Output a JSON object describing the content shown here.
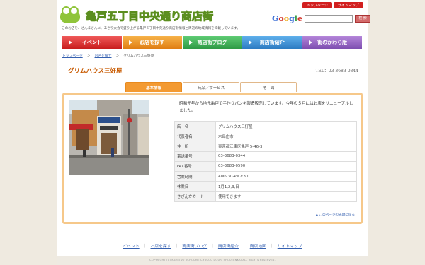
{
  "header": {
    "title": "亀戸五丁目中央通り商店街",
    "tagline": "このお店を、さんまさんに、あさり大会で盛り上がる亀戸５丁目中央通り商店街情報と周辺の地域情報を掲載しています。",
    "toplinks": [
      "トップページ",
      "サイトマップ"
    ],
    "search_button": "検 索"
  },
  "nav": [
    "イベント",
    "お店を探す",
    "商店街ブログ",
    "商店街紹介",
    "街のかわら版"
  ],
  "breadcrumb": [
    "トップページ",
    "お店を探す",
    "グリムハウス三好屋"
  ],
  "shop": {
    "name": "グリムハウス三好屋",
    "tel": "TEL：03-3683-0344",
    "description": "昭和元年から地元亀戸で手作りパンを製造販売しています。今年の５月にはお店をリニューアルしました。",
    "tabs": [
      "基本情報",
      "商品／サービス",
      "地　図"
    ],
    "info": [
      {
        "k": "店　名",
        "v": "グリムハウス三好屋"
      },
      {
        "k": "代表者名",
        "v": "木島庄市"
      },
      {
        "k": "住　所",
        "v": "東京都江東区亀戸 5-46-3"
      },
      {
        "k": "電話番号",
        "v": "03-3683-0344"
      },
      {
        "k": "FAX番号",
        "v": "03-3683-0590"
      },
      {
        "k": "営業時間",
        "v": "AM6:30-PM7:30"
      },
      {
        "k": "休業日",
        "v": "1月1,2,3,日"
      },
      {
        "k": "さざんかカード",
        "v": "使用できます"
      }
    ],
    "pagetop": "▲ このページの先頭に戻る"
  },
  "footer": {
    "links": [
      "イベント",
      "お店を探す",
      "商店街ブログ",
      "商店街紹介",
      "商店地図",
      "サイトマップ"
    ],
    "copyright": "COPYRIGHT (C) KAMEIDO 5CHOUME CHUUOU DOURI SHOUTENKAI ALL RIGHTS RESERVED."
  }
}
